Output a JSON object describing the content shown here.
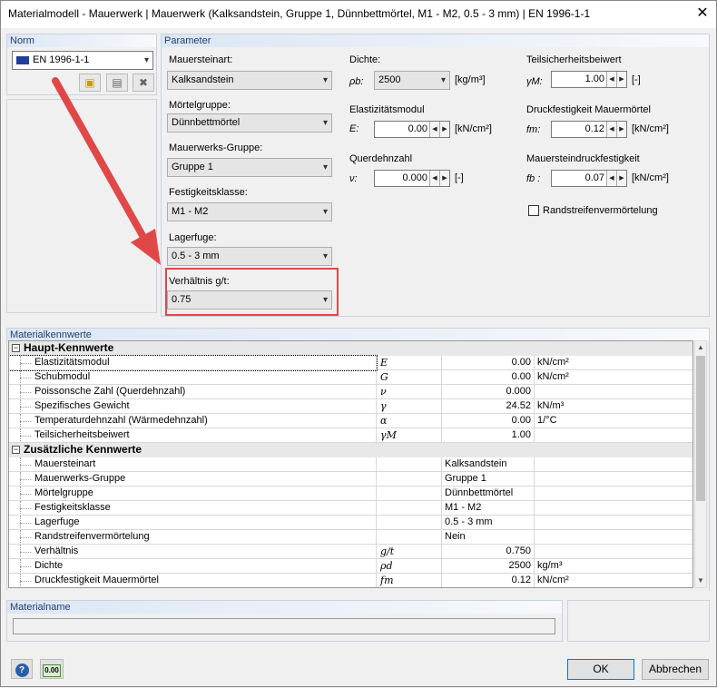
{
  "window": {
    "title": "Materialmodell - Mauerwerk | Mauerwerk (Kalksandstein, Gruppe 1, Dünnbettmörtel, M1 - M2, 0.5 - 3 mm) | EN 1996-1-1",
    "close_glyph": "✕"
  },
  "norm": {
    "header": "Norm",
    "selected": "EN 1996-1-1"
  },
  "parameter": {
    "header": "Parameter",
    "mauersteinart": {
      "label": "Mauersteinart:",
      "value": "Kalksandstein"
    },
    "moertelgruppe": {
      "label": "Mörtelgruppe:",
      "value": "Dünnbettmörtel"
    },
    "mauerwerksgruppe": {
      "label": "Mauerwerks-Gruppe:",
      "value": "Gruppe 1"
    },
    "festigkeitsklasse": {
      "label": "Festigkeitsklasse:",
      "value": "M1 - M2"
    },
    "lagerfuge": {
      "label": "Lagerfuge:",
      "value": "0.5 - 3 mm"
    },
    "verhaeltnis": {
      "label": "Verhältnis g/t:",
      "value": "0.75"
    },
    "dichte": {
      "label": "Dichte:",
      "symbol": "ρb:",
      "value": "2500",
      "unit": "[kg/m³]"
    },
    "emodul": {
      "label": "Elastizitätsmodul",
      "symbol": "E:",
      "value": "0.00",
      "unit": "[kN/cm²]"
    },
    "querdehnzahl": {
      "label": "Querdehnzahl",
      "symbol": "ν:",
      "value": "0.000",
      "unit": "[-]"
    },
    "teilsicherheit": {
      "label": "Teilsicherheitsbeiwert",
      "symbol": "γM:",
      "value": "1.00",
      "unit": "[-]"
    },
    "druck_moertel": {
      "label": "Druckfestigkeit Mauermörtel",
      "symbol": "fm:",
      "value": "0.12",
      "unit": "[kN/cm²]"
    },
    "druck_stein": {
      "label": "Mauersteindruckfestigkeit",
      "symbol": "fb :",
      "value": "0.07",
      "unit": "[kN/cm²]"
    },
    "randstreifen": {
      "label": "Randstreifenvermörtelung",
      "checked": false
    }
  },
  "kennwerte": {
    "header": "Materialkennwerte",
    "haupt_title": "Haupt-Kennwerte",
    "haupt": [
      {
        "name": "Elastizitätsmodul",
        "sym": "E",
        "val": "0.00",
        "unit": "kN/cm²"
      },
      {
        "name": "Schubmodul",
        "sym": "G",
        "val": "0.00",
        "unit": "kN/cm²"
      },
      {
        "name": "Poissonsche Zahl (Querdehnzahl)",
        "sym": "ν",
        "val": "0.000",
        "unit": ""
      },
      {
        "name": "Spezifisches Gewicht",
        "sym": "γ",
        "val": "24.52",
        "unit": "kN/m³"
      },
      {
        "name": "Temperaturdehnzahl (Wärmedehnzahl)",
        "sym": "α",
        "val": "0.00",
        "unit": "1/°C"
      },
      {
        "name": "Teilsicherheitsbeiwert",
        "sym": "γM",
        "val": "1.00",
        "unit": ""
      }
    ],
    "zus_title": "Zusätzliche Kennwerte",
    "zus": [
      {
        "name": "Mauersteinart",
        "sym": "",
        "txt": "Kalksandstein",
        "val": "",
        "unit": ""
      },
      {
        "name": "Mauerwerks-Gruppe",
        "sym": "",
        "txt": "Gruppe 1",
        "val": "",
        "unit": ""
      },
      {
        "name": "Mörtelgruppe",
        "sym": "",
        "txt": "Dünnbettmörtel",
        "val": "",
        "unit": ""
      },
      {
        "name": "Festigkeitsklasse",
        "sym": "",
        "txt": "M1 - M2",
        "val": "",
        "unit": ""
      },
      {
        "name": "Lagerfuge",
        "sym": "",
        "txt": "0.5 - 3 mm",
        "val": "",
        "unit": ""
      },
      {
        "name": "Randstreifenvermörtelung",
        "sym": "",
        "txt": "Nein",
        "val": "",
        "unit": ""
      },
      {
        "name": "Verhältnis",
        "sym": "g/t",
        "txt": "",
        "val": "0.750",
        "unit": ""
      },
      {
        "name": "Dichte",
        "sym": "ρd",
        "txt": "",
        "val": "2500",
        "unit": "kg/m³"
      },
      {
        "name": "Druckfestigkeit Mauermörtel",
        "sym": "fm",
        "txt": "",
        "val": "0.12",
        "unit": "kN/cm²"
      }
    ]
  },
  "materialname": {
    "header": "Materialname",
    "value": ""
  },
  "buttons": {
    "ok": "OK",
    "cancel": "Abbrechen",
    "units_icon_text": "0.00"
  },
  "colors": {
    "highlight": "#e04848",
    "arrow": "#e04848"
  }
}
